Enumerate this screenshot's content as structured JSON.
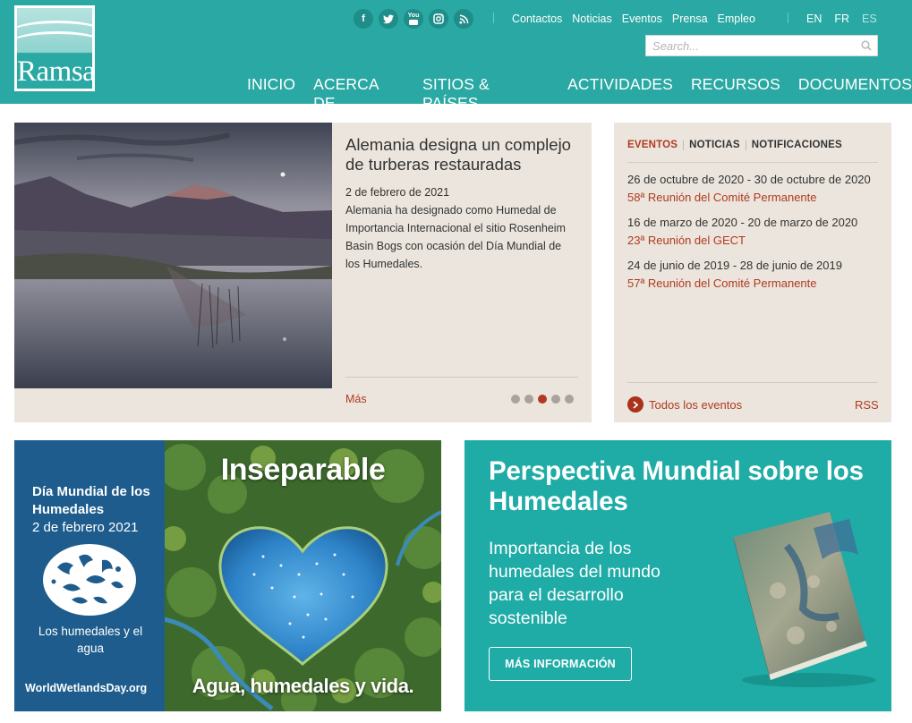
{
  "header": {
    "logo_text": "Ramsar",
    "social": [
      {
        "icon": "facebook-icon",
        "glyph": "f"
      },
      {
        "icon": "twitter-icon",
        "glyph": "t"
      },
      {
        "icon": "youtube-icon",
        "glyph": "You"
      },
      {
        "icon": "instagram-icon",
        "glyph": "◎"
      },
      {
        "icon": "rss-icon",
        "glyph": "◗"
      }
    ],
    "top_links": [
      "Contactos",
      "Noticias",
      "Eventos",
      "Prensa",
      "Empleo"
    ],
    "languages": [
      {
        "code": "EN",
        "active": true
      },
      {
        "code": "FR",
        "active": true
      },
      {
        "code": "ES",
        "active": false
      }
    ],
    "search": {
      "placeholder": "Search..."
    },
    "main_nav": [
      "INICIO",
      "ACERCA DE",
      "SITIOS & PAÍSES",
      "ACTIVIDADES",
      "RECURSOS",
      "DOCUMENTOS"
    ]
  },
  "news": {
    "title": "Alemania designa un complejo de turberas restauradas",
    "date": "2 de febrero de 2021",
    "text": "Alemania ha designado como Humedal de Importancia Internacional el sitio Rosenheim Basin Bogs con ocasión del Día Mundial de los Humedales.",
    "more_label": "Más",
    "slides_total": 5,
    "slide_active": 3
  },
  "events": {
    "tabs": [
      "EVENTOS",
      "NOTICIAS",
      "NOTIFICACIONES"
    ],
    "active_tab": "EVENTOS",
    "items": [
      {
        "dates": "26 de octubre de 2020 - 30 de octubre de 2020",
        "name": "58ª Reunión del Comité Permanente"
      },
      {
        "dates": "16 de marzo de 2020 - 20 de marzo de 2020",
        "name": "23ª Reunión del GECT"
      },
      {
        "dates": "24 de junio de 2019 - 28 de junio de 2019",
        "name": "57ª Reunión del Comité Permanente"
      }
    ],
    "all_label": "Todos los eventos",
    "rss_label": "RSS"
  },
  "wwd_banner": {
    "title": "Día Mundial de los Humedales",
    "date": "2 de febrero 2021",
    "theme": "Los humedales y el agua",
    "site": "WorldWetlandsDay.org",
    "headline": "Inseparable",
    "tagline": "Agua, humedales y vida."
  },
  "gwo_banner": {
    "title": "Perspectiva Mundial sobre los Humedales",
    "subtitle": "Importancia de los humedales del mundo para el desarrollo sostenible",
    "button_label": "MÁS INFORMACIÓN"
  },
  "colors": {
    "teal": "#2aa8a3",
    "teal_banner": "#1faba6",
    "beige": "#ebe5dd",
    "accent": "#b03a1f",
    "wwd_blue": "#1d5c8c"
  }
}
